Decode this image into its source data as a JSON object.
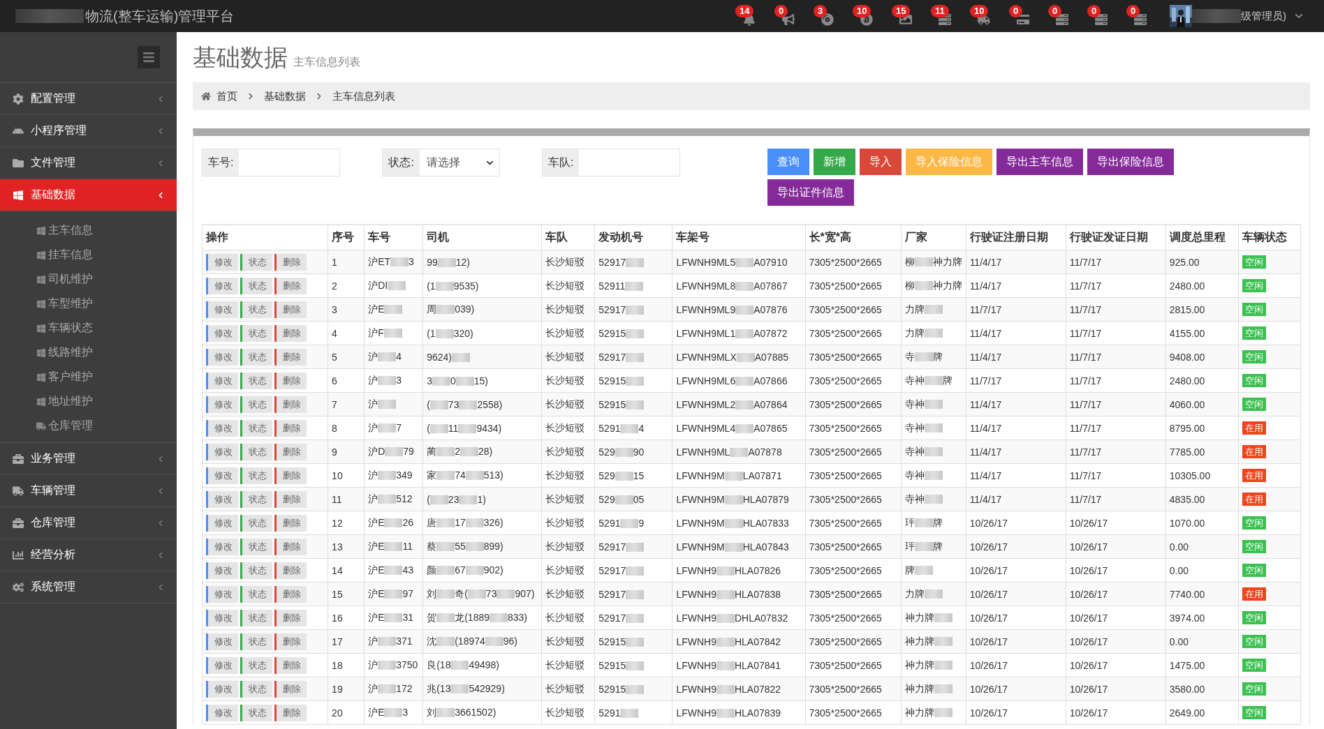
{
  "topbar": {
    "title": "物流(整车运输)管理平台",
    "badges": [
      {
        "count": "14"
      },
      {
        "count": "0"
      },
      {
        "count": "3"
      },
      {
        "count": "10"
      },
      {
        "count": "15"
      },
      {
        "count": "11"
      },
      {
        "count": "10"
      },
      {
        "count": "0"
      },
      {
        "count": "0"
      },
      {
        "count": "0"
      },
      {
        "count": "0"
      }
    ],
    "user": "级管理员)"
  },
  "sidebar": {
    "items": [
      {
        "label": "配置管理",
        "selected": false
      },
      {
        "label": "小程序管理",
        "selected": false
      },
      {
        "label": "文件管理",
        "selected": false
      },
      {
        "label": "基础数据",
        "selected": true,
        "children": [
          {
            "label": "主车信息"
          },
          {
            "label": "挂车信息"
          },
          {
            "label": "司机维护"
          },
          {
            "label": "车型维护"
          },
          {
            "label": "车辆状态"
          },
          {
            "label": "线路维护"
          },
          {
            "label": "客户维护"
          },
          {
            "label": "地址维护"
          },
          {
            "label": "仓库管理"
          }
        ]
      },
      {
        "label": "业务管理",
        "selected": false
      },
      {
        "label": "车辆管理",
        "selected": false
      },
      {
        "label": "仓库管理",
        "selected": false
      },
      {
        "label": "经营分析",
        "selected": false
      },
      {
        "label": "系统管理",
        "selected": false
      }
    ]
  },
  "page": {
    "title": "基础数据",
    "subtitle": "主车信息列表"
  },
  "breadcrumb": [
    "首页",
    "基础数据",
    "主车信息列表"
  ],
  "filters": [
    {
      "label": "车号:",
      "kind": "text"
    },
    {
      "label": "状态:",
      "kind": "select",
      "value": "请选择"
    },
    {
      "label": "车队:",
      "kind": "text"
    }
  ],
  "buttons": [
    {
      "label": "查询",
      "color": "#4a8ef8"
    },
    {
      "label": "新增",
      "color": "#34a94a"
    },
    {
      "label": "导入",
      "color": "#d9493a"
    },
    {
      "label": "导入保险信息",
      "color": "#fdb747"
    },
    {
      "label": "导出主车信息",
      "color": "#852b99"
    },
    {
      "label": "导出保险信息",
      "color": "#852b99"
    },
    {
      "label": "导出证件信息",
      "color": "#852b99"
    }
  ],
  "table": {
    "columns": [
      "操作",
      "序号",
      "车号",
      "司机",
      "车队",
      "发动机号",
      "车架号",
      "长*宽*高",
      "厂家",
      "行驶证注册日期",
      "行驶证发证日期",
      "调度总里程",
      "车辆状态"
    ],
    "rows": [
      {
        "actions": [
          "修改",
          "状态",
          "删除"
        ],
        "no": "1",
        "car": [
          "沪ET",
          "3"
        ],
        "driver": [
          "99",
          "12)"
        ],
        "team": "长沙短驳",
        "engine": [
          "52917"
        ],
        "frame": [
          "LFWNH9ML5",
          "A07910"
        ],
        "size": "7305*2500*2665",
        "maker": [
          "柳",
          "神力牌"
        ],
        "reg": "11/4/17",
        "issue": "11/7/17",
        "mileage": "925.00",
        "status": {
          "text": "空闲",
          "kind": "idle"
        }
      },
      {
        "actions": [
          "修改",
          "状态",
          "删除"
        ],
        "no": "2",
        "car": [
          "沪DI"
        ],
        "driver": [
          "(1",
          "9535)"
        ],
        "team": "长沙短驳",
        "engine": [
          "52911"
        ],
        "frame": [
          "LFWNH9ML8",
          "A07867"
        ],
        "size": "7305*2500*2665",
        "maker": [
          "柳",
          "神力牌"
        ],
        "reg": "11/4/17",
        "issue": "11/7/17",
        "mileage": "2480.00",
        "status": {
          "text": "空闲",
          "kind": "idle"
        }
      },
      {
        "actions": [
          "修改",
          "状态",
          "删除"
        ],
        "no": "3",
        "car": [
          "沪E"
        ],
        "driver": [
          "周",
          "039)"
        ],
        "team": "长沙短驳",
        "engine": [
          "52917"
        ],
        "frame": [
          "LFWNH9ML9",
          "A07876"
        ],
        "size": "7305*2500*2665",
        "maker": [
          "力牌"
        ],
        "reg": "11/7/17",
        "issue": "11/7/17",
        "mileage": "2815.00",
        "status": {
          "text": "空闲",
          "kind": "idle"
        }
      },
      {
        "actions": [
          "修改",
          "状态",
          "删除"
        ],
        "no": "4",
        "car": [
          "沪F"
        ],
        "driver": [
          "(1",
          "320)"
        ],
        "team": "长沙短驳",
        "engine": [
          "52915"
        ],
        "frame": [
          "LFWNH9ML1",
          "A07872"
        ],
        "size": "7305*2500*2665",
        "maker": [
          "力牌"
        ],
        "reg": "11/4/17",
        "issue": "11/7/17",
        "mileage": "4155.00",
        "status": {
          "text": "空闲",
          "kind": "idle"
        }
      },
      {
        "actions": [
          "修改",
          "状态",
          "删除"
        ],
        "no": "5",
        "car": [
          "沪",
          "4"
        ],
        "driver": [
          "9624)"
        ],
        "team": "长沙短驳",
        "engine": [
          "52917"
        ],
        "frame": [
          "LFWNH9MLX",
          "A07885"
        ],
        "size": "7305*2500*2665",
        "maker": [
          "寺",
          "牌"
        ],
        "reg": "11/4/17",
        "issue": "11/7/17",
        "mileage": "9408.00",
        "status": {
          "text": "空闲",
          "kind": "idle"
        }
      },
      {
        "actions": [
          "修改",
          "状态",
          "删除"
        ],
        "no": "6",
        "car": [
          "沪",
          "3"
        ],
        "driver": [
          "3",
          "0",
          "15)"
        ],
        "team": "长沙短驳",
        "engine": [
          "52915"
        ],
        "frame": [
          "LFWNH9ML6",
          "A07866"
        ],
        "size": "7305*2500*2665",
        "maker": [
          "寺神",
          "牌"
        ],
        "reg": "11/7/17",
        "issue": "11/7/17",
        "mileage": "2480.00",
        "status": {
          "text": "空闲",
          "kind": "idle"
        }
      },
      {
        "actions": [
          "修改",
          "状态",
          "删除"
        ],
        "no": "7",
        "car": [
          "沪"
        ],
        "driver": [
          "(",
          "73",
          "2558)"
        ],
        "team": "长沙短驳",
        "engine": [
          "52915"
        ],
        "frame": [
          "LFWNH9ML2",
          "A07864"
        ],
        "size": "7305*2500*2665",
        "maker": [
          "寺神"
        ],
        "reg": "11/4/17",
        "issue": "11/7/17",
        "mileage": "4060.00",
        "status": {
          "text": "空闲",
          "kind": "idle"
        }
      },
      {
        "actions": [
          "修改",
          "状态",
          "删除"
        ],
        "no": "8",
        "car": [
          "沪",
          "7"
        ],
        "driver": [
          "(",
          "11",
          "9434)"
        ],
        "team": "长沙短驳",
        "engine": [
          "5291",
          "4"
        ],
        "frame": [
          "LFWNH9ML4",
          "A07865"
        ],
        "size": "7305*2500*2665",
        "maker": [
          "寺神"
        ],
        "reg": "11/4/17",
        "issue": "11/7/17",
        "mileage": "8795.00",
        "status": {
          "text": "在用",
          "kind": "busy"
        }
      },
      {
        "actions": [
          "修改",
          "状态",
          "删除"
        ],
        "no": "9",
        "car": [
          "沪D",
          "79"
        ],
        "driver": [
          "蔺",
          "2",
          "28)"
        ],
        "team": "长沙短驳",
        "engine": [
          "529",
          "90"
        ],
        "frame": [
          "LFWNH9ML",
          "A07878"
        ],
        "size": "7305*2500*2665",
        "maker": [
          "寺神"
        ],
        "reg": "11/4/17",
        "issue": "11/7/17",
        "mileage": "7785.00",
        "status": {
          "text": "在用",
          "kind": "busy"
        }
      },
      {
        "actions": [
          "修改",
          "状态",
          "删除"
        ],
        "no": "10",
        "car": [
          "沪",
          "349"
        ],
        "driver": [
          "家",
          "74",
          "513)"
        ],
        "team": "长沙短驳",
        "engine": [
          "529",
          "15"
        ],
        "frame": [
          "LFWNH9M",
          "LA07871"
        ],
        "size": "7305*2500*2665",
        "maker": [
          "寺神"
        ],
        "reg": "11/4/17",
        "issue": "11/7/17",
        "mileage": "10305.00",
        "status": {
          "text": "在用",
          "kind": "busy"
        }
      },
      {
        "actions": [
          "修改",
          "状态",
          "删除"
        ],
        "no": "11",
        "car": [
          "沪",
          "512"
        ],
        "driver": [
          "(",
          "23",
          "1)"
        ],
        "team": "长沙短驳",
        "engine": [
          "529",
          "05"
        ],
        "frame": [
          "LFWNH9M",
          "HLA07879"
        ],
        "size": "7305*2500*2665",
        "maker": [
          "寺神"
        ],
        "reg": "11/4/17",
        "issue": "11/7/17",
        "mileage": "4835.00",
        "status": {
          "text": "在用",
          "kind": "busy"
        }
      },
      {
        "actions": [
          "修改",
          "状态",
          "删除"
        ],
        "no": "12",
        "car": [
          "沪E",
          "26"
        ],
        "driver": [
          "唐",
          "17",
          "326)"
        ],
        "team": "长沙短驳",
        "engine": [
          "5291",
          "9"
        ],
        "frame": [
          "LFWNH9M",
          "HLA07833"
        ],
        "size": "7305*2500*2665",
        "maker": [
          "玶",
          "牌"
        ],
        "reg": "10/26/17",
        "issue": "10/26/17",
        "mileage": "1070.00",
        "status": {
          "text": "空闲",
          "kind": "idle"
        }
      },
      {
        "actions": [
          "修改",
          "状态",
          "删除"
        ],
        "no": "13",
        "car": [
          "沪E",
          "11"
        ],
        "driver": [
          "蔡",
          "55",
          "899)"
        ],
        "team": "长沙短驳",
        "engine": [
          "52917"
        ],
        "frame": [
          "LFWNH9M",
          "HLA07843"
        ],
        "size": "7305*2500*2665",
        "maker": [
          "玶",
          "牌"
        ],
        "reg": "10/26/17",
        "issue": "10/26/17",
        "mileage": "0.00",
        "status": {
          "text": "空闲",
          "kind": "idle"
        }
      },
      {
        "actions": [
          "修改",
          "状态",
          "删除"
        ],
        "no": "14",
        "car": [
          "沪E",
          "43"
        ],
        "driver": [
          "颜",
          "67",
          "902)"
        ],
        "team": "长沙短驳",
        "engine": [
          "52917"
        ],
        "frame": [
          "LFWNH9",
          "HLA07826"
        ],
        "size": "7305*2500*2665",
        "maker": [
          "牌"
        ],
        "reg": "10/26/17",
        "issue": "10/26/17",
        "mileage": "0.00",
        "status": {
          "text": "空闲",
          "kind": "idle"
        }
      },
      {
        "actions": [
          "修改",
          "状态",
          "删除"
        ],
        "no": "15",
        "car": [
          "沪E",
          "97"
        ],
        "driver": [
          "刘",
          "奇(",
          "73",
          "907)"
        ],
        "team": "长沙短驳",
        "engine": [
          "52917"
        ],
        "frame": [
          "LFWNH9",
          "HLA07838"
        ],
        "size": "7305*2500*2665",
        "maker": [
          "力牌"
        ],
        "reg": "10/26/17",
        "issue": "10/26/17",
        "mileage": "7740.00",
        "status": {
          "text": "在用",
          "kind": "busy"
        }
      },
      {
        "actions": [
          "修改",
          "状态",
          "删除"
        ],
        "no": "16",
        "car": [
          "沪E",
          "31"
        ],
        "driver": [
          "贺",
          "龙(1889",
          "833)"
        ],
        "team": "长沙短驳",
        "engine": [
          "52917"
        ],
        "frame": [
          "LFWNH9",
          "DHLA07832"
        ],
        "size": "7305*2500*2665",
        "maker": [
          "神力牌"
        ],
        "reg": "10/26/17",
        "issue": "10/26/17",
        "mileage": "3974.00",
        "status": {
          "text": "空闲",
          "kind": "idle"
        }
      },
      {
        "actions": [
          "修改",
          "状态",
          "删除"
        ],
        "no": "17",
        "car": [
          "沪",
          "371"
        ],
        "driver": [
          "沈",
          "(18974",
          "96)"
        ],
        "team": "长沙短驳",
        "engine": [
          "52915"
        ],
        "frame": [
          "LFWNH9",
          "HLA07842"
        ],
        "size": "7305*2500*2665",
        "maker": [
          "神力牌"
        ],
        "reg": "10/26/17",
        "issue": "10/26/17",
        "mileage": "0.00",
        "status": {
          "text": "空闲",
          "kind": "idle"
        }
      },
      {
        "actions": [
          "修改",
          "状态",
          "删除"
        ],
        "no": "18",
        "car": [
          "沪",
          "3750"
        ],
        "driver": [
          "良(18",
          "49498)"
        ],
        "team": "长沙短驳",
        "engine": [
          "52915"
        ],
        "frame": [
          "LFWNH9",
          "HLA07841"
        ],
        "size": "7305*2500*2665",
        "maker": [
          "神力牌"
        ],
        "reg": "10/26/17",
        "issue": "10/26/17",
        "mileage": "1475.00",
        "status": {
          "text": "空闲",
          "kind": "idle"
        }
      },
      {
        "actions": [
          "修改",
          "状态",
          "删除"
        ],
        "no": "19",
        "car": [
          "沪",
          "172"
        ],
        "driver": [
          "兆(13",
          "542929)"
        ],
        "team": "长沙短驳",
        "engine": [
          "52915"
        ],
        "frame": [
          "LFWNH9",
          "HLA07822"
        ],
        "size": "7305*2500*2665",
        "maker": [
          "神力牌"
        ],
        "reg": "10/26/17",
        "issue": "10/26/17",
        "mileage": "3580.00",
        "status": {
          "text": "空闲",
          "kind": "idle"
        }
      },
      {
        "actions": [
          "修改",
          "状态",
          "删除"
        ],
        "no": "20",
        "car": [
          "沪E",
          "3"
        ],
        "driver": [
          "刘",
          "3661502)"
        ],
        "team": "长沙短驳",
        "engine": [
          "5291"
        ],
        "frame": [
          "LFWNH9",
          "HLA07839"
        ],
        "size": "7305*2500*2665",
        "maker": [
          "神力牌"
        ],
        "reg": "10/26/17",
        "issue": "10/26/17",
        "mileage": "2649.00",
        "status": {
          "text": "空闲",
          "kind": "idle"
        }
      }
    ]
  }
}
